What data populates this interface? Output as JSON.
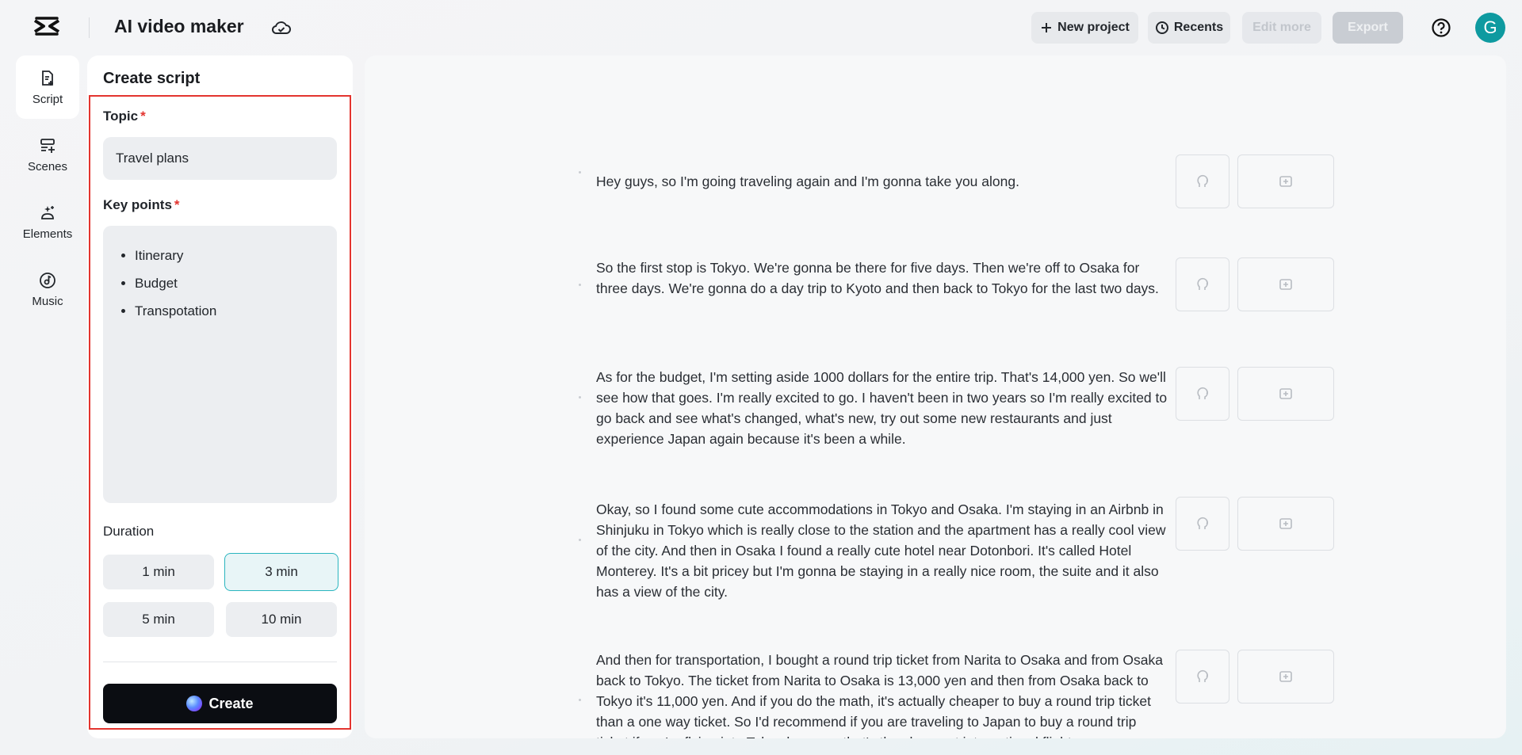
{
  "header": {
    "app_title": "AI video maker",
    "new_project_label": "New project",
    "recents_label": "Recents",
    "edit_more_label": "Edit more",
    "export_label": "Export",
    "avatar_initial": "G"
  },
  "nav": {
    "items": [
      {
        "label": "Script",
        "icon": "script-icon",
        "active": true
      },
      {
        "label": "Scenes",
        "icon": "scenes-icon",
        "active": false
      },
      {
        "label": "Elements",
        "icon": "elements-icon",
        "active": false
      },
      {
        "label": "Music",
        "icon": "music-icon",
        "active": false
      }
    ]
  },
  "panel": {
    "title": "Create script",
    "topic_label": "Topic",
    "required_mark": "*",
    "topic_value": "Travel plans",
    "keypoints_label": "Key points",
    "keypoints": [
      "Itinerary",
      "Budget",
      "Transpotation"
    ],
    "duration_label": "Duration",
    "durations": [
      "1 min",
      "3 min",
      "5 min",
      "10 min"
    ],
    "selected_duration": "3 min",
    "create_label": "Create"
  },
  "script": {
    "paragraphs": [
      "Hey guys, so I'm going traveling again and I'm gonna take you along.",
      "So the first stop is Tokyo. We're gonna be there for five days. Then we're off to Osaka for three days. We're gonna do a day trip to Kyoto and then back to Tokyo for the last two days.",
      "As for the budget, I'm setting aside 1000 dollars for the entire trip. That's 14,000 yen. So we'll see how that goes. I'm really excited to go. I haven't been in two years so I'm really excited to go back and see what's changed, what's new, try out some new restaurants and just experience Japan again because it's been a while.",
      "Okay, so I found some cute accommodations in Tokyo and Osaka. I'm staying in an Airbnb in Shinjuku in Tokyo which is really close to the station and the apartment has a really cool view of the city. And then in Osaka I found a really cute hotel near Dotonbori. It's called Hotel Monterey. It's a bit pricey but I'm gonna be staying in a really nice room, the suite and it also has a view of the city.",
      "And then for transportation, I bought a round trip ticket from Narita to Osaka and from Osaka back to Tokyo. The ticket from Narita to Osaka is 13,000 yen and then from Osaka back to Tokyo it's 11,000 yen. And if you do the math, it's actually cheaper to buy a round trip ticket than a one way ticket. So I'd recommend if you are traveling to Japan to buy a round trip ticket if you're flying into Tokyo because that's the cheapest international flight."
    ]
  },
  "colors": {
    "accent": "#2ab5bf",
    "required": "#e3342f",
    "avatar": "#0e9aa0"
  }
}
